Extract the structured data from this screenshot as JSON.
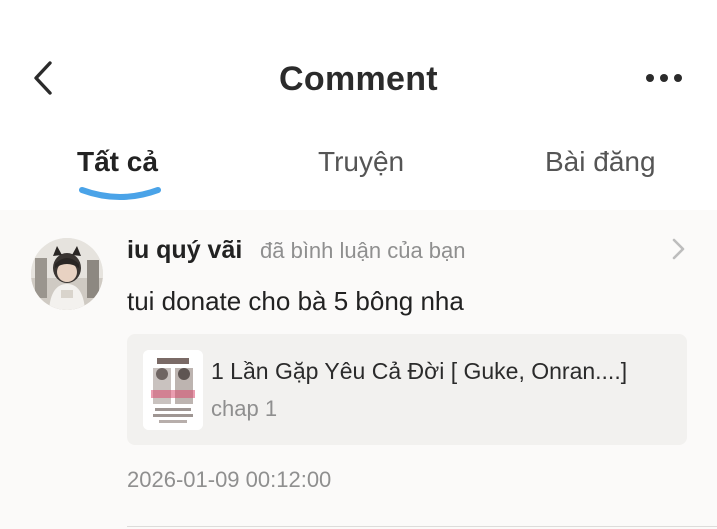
{
  "header": {
    "title": "Comment",
    "back_icon": "chevron-left-icon",
    "more_icon": "more-horizontal-icon"
  },
  "tabs": [
    {
      "label": "Tất cả",
      "active": true
    },
    {
      "label": "Truyện",
      "active": false
    },
    {
      "label": "Bài đăng",
      "active": false
    }
  ],
  "colors": {
    "accent": "#4aa3e8",
    "text_primary": "#222222",
    "text_secondary": "#8f8f8f",
    "feed_background": "#fbfaf9",
    "card_background": "#f2f1ef"
  },
  "notification": {
    "username": "iu quý vãi",
    "action": "đã bình luận của bạn",
    "comment": "tui donate cho bà 5 bông nha",
    "story": {
      "title": "1 Lần Gặp Yêu Cả Đời [ Guke, Onran....]",
      "chapter": "chap 1"
    },
    "timestamp": "2026-01-09 00:12:00"
  }
}
